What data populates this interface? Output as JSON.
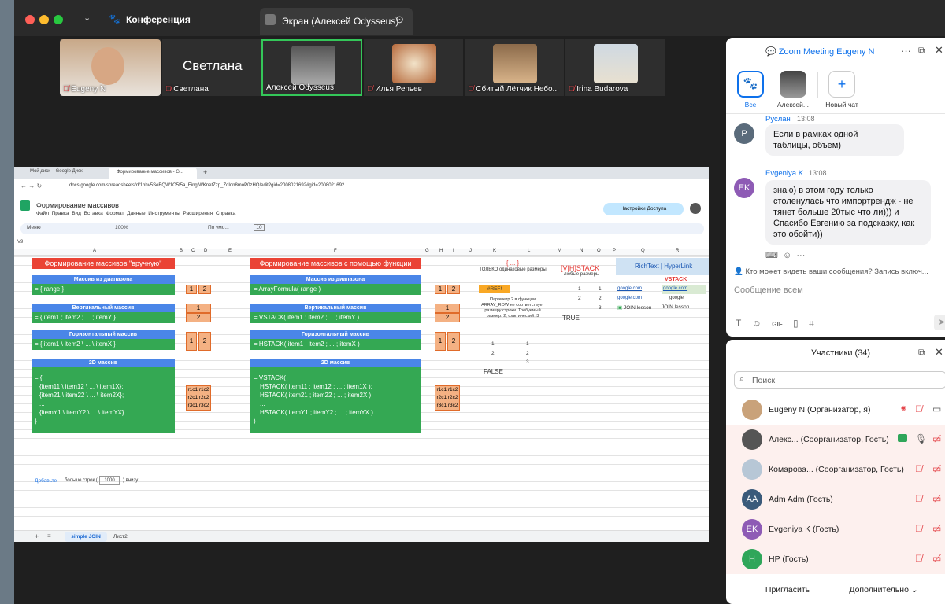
{
  "titlebar": {
    "app_title": "Конференция",
    "share_tab": "Экран (Алексей Odysseus)"
  },
  "participants_strip": [
    {
      "name": "Eugeny N"
    },
    {
      "name": "Светлана",
      "big": "Светлана"
    },
    {
      "name": "Алексей Odysseus"
    },
    {
      "name": "Илья Репьев"
    },
    {
      "name": "Сбитый Лётчик Небо..."
    },
    {
      "name": "Irina Budarova"
    }
  ],
  "browser": {
    "tabs": [
      "Мой диск – Google Диск",
      "Формирование массивов - G..."
    ],
    "url": "docs.google.com/spreadsheets/d/1hhv5SeBQW1O5f5a_EinglWKnetZzp_Zdlon8moP0zHQ/edit?gid=2008021692#gid=2008021692"
  },
  "sheet": {
    "title": "Формирование массивов",
    "menus": [
      "Файл",
      "Правка",
      "Вид",
      "Вставка",
      "Формат",
      "Данные",
      "Инструменты",
      "Расширения",
      "Справка"
    ],
    "share": "Настройки Доступа",
    "menu_search": "Меню",
    "zoom": "100%",
    "font": "По умо...",
    "font_size": "10",
    "namebox": "V9",
    "cols": [
      "A",
      "B",
      "C",
      "D",
      "E",
      "F",
      "G",
      "H",
      "I",
      "J",
      "K",
      "L",
      "M",
      "N",
      "O",
      "P",
      "Q",
      "R"
    ],
    "h1_left": "Формирование массивов \"вручную\"",
    "h1_right": "Формирование массивов с помощью функции",
    "b1_left": "Массив из диапазона",
    "b1_right": "Массив из диапазона",
    "g1_left": "= { range }",
    "g1_right": "= ArrayFormula( range )",
    "b2_left": "Вертикальный массив",
    "b2_right": "Вертикальный массив",
    "g2_left": "= { item1 ; item2 ; ... ; itemY }",
    "g2_right": "= VSTACK( item1 ; item2 ; ... ; itemY )",
    "b3_left": "Горизонтальный массив",
    "b3_right": "Горизонтальный массив",
    "g3_left": "= { item1 \\ item2 \\ ... \\ itemX }",
    "g3_right": "= HSTACK( item1 ; item2 ; ... ; itemX )",
    "b4_left": "2D массив",
    "b4_right": "2D массив",
    "g4_left": [
      "= {",
      "{item11 \\ item12 \\ ... \\ item1X};",
      "{item21 \\ item22 \\ ... \\ item2X};",
      "...",
      "{itemY1 \\ itemY2 \\ ... \\ itemYX}",
      "}"
    ],
    "g4_right": [
      "= VSTACK(",
      "HSTACK( item11 ; item12 ; ... ; item1X );",
      "HSTACK( item21 ; item22 ; ... ; item2X );",
      "...",
      "HSTACK( itemY1 ; itemY2 ; ... ; itemYX )",
      ")"
    ],
    "k_header": "{ ... }",
    "k_sub": "ТОЛЬКО одинаковые размеры",
    "k_ref": "#REF!",
    "k_note": "Параметр 2 в функции ARRAY_ROW не соответствует размеру строки. Требуемый размер: 2, фактический: 3",
    "k_false": "FALSE",
    "n_header": "[V|H]STACK",
    "n_sub": "любые размеры",
    "n_true": "TRUE",
    "q_header": "RichText | HyperLink |",
    "r_vstack": "VSTACK",
    "q_links": [
      "google.com",
      "google.com",
      "google"
    ],
    "q_join": [
      "JOIN lesson",
      "JOIN lesson"
    ],
    "add_rows": "Добавьте",
    "more_rows": "больше строк (",
    "rows_count": "1000",
    "below": ") внизу",
    "sheet_tabs": [
      "simple JOIN",
      "Лист2"
    ]
  },
  "chat": {
    "title": "Zoom Meeting Eugeny N",
    "filters": [
      "Все",
      "Алексей...",
      "Новый чат"
    ],
    "messages": [
      {
        "author": "Руслан",
        "time": "13:08",
        "initial": "Р",
        "text": "Если в рамках одной таблицы, объем)"
      },
      {
        "author": "Evgeniya K",
        "time": "13:08",
        "initial": "EK",
        "text": "знаю) в этом году только столенулась что импортрендж - не тянет больше 20тыс что ли))) и Спасибо Евгению за подсказку, как это обойти))"
      }
    ],
    "privacy": "Кто может видеть ваши сообщения? Запись включ...",
    "placeholder": "Сообщение всем"
  },
  "participants": {
    "title": "Участники (34)",
    "search": "Поиск",
    "list": [
      {
        "initials": "",
        "name": "Eugeny N (Организатор, я)",
        "color": "#c9a27a"
      },
      {
        "initials": "",
        "name": "Алекс... (Соорганизатор, Гость)",
        "color": "#555555"
      },
      {
        "initials": "",
        "name": "Комарова... (Соорганизатор, Гость)",
        "color": "#b7c7d6"
      },
      {
        "initials": "AA",
        "name": "Adm Adm (Гость)",
        "color": "#3a5a7a"
      },
      {
        "initials": "EK",
        "name": "Evgeniya K (Гость)",
        "color": "#8e5bb5"
      },
      {
        "initials": "H",
        "name": "HP (Гость)",
        "color": "#2fa65a"
      }
    ],
    "invite": "Пригласить",
    "more": "Дополнительно"
  }
}
